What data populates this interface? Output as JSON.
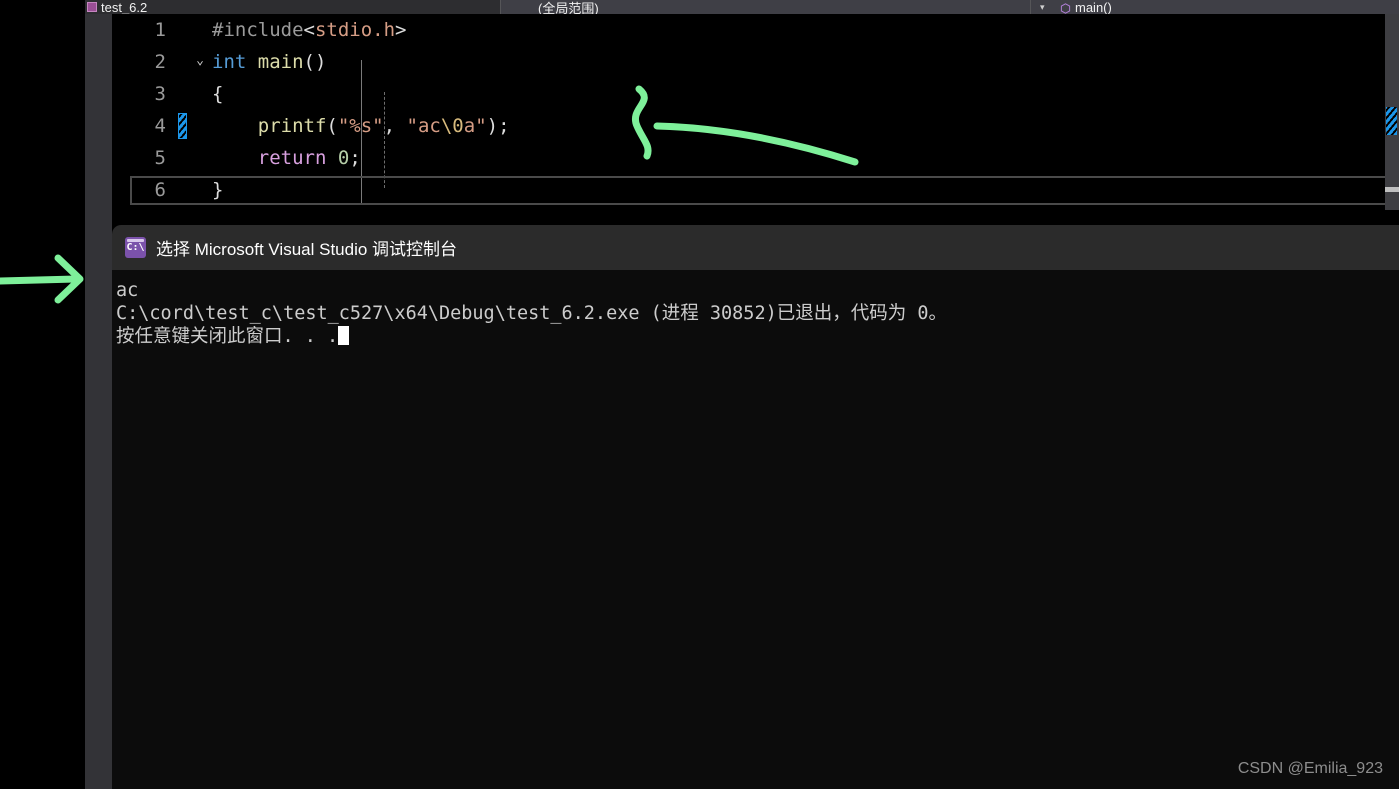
{
  "window": {
    "topbar": {
      "file_tab": {
        "label": "test_6.2",
        "icon": "c-file-icon"
      },
      "scope_dropdown": {
        "label": "(全局范围)",
        "icon": "chevron-down-icon"
      },
      "member_dropdown": {
        "label": "main()",
        "icon": "method-cube-icon"
      }
    }
  },
  "editor": {
    "lines": [
      {
        "number": "1",
        "changed": false,
        "fold": "",
        "text": "#include<stdio.h>"
      },
      {
        "number": "2",
        "changed": false,
        "fold": "open",
        "text": "int main()"
      },
      {
        "number": "3",
        "changed": false,
        "fold": "",
        "text": "{"
      },
      {
        "number": "4",
        "changed": true,
        "fold": "",
        "text": "printf(\"%s\", \"ac\\0a\");"
      },
      {
        "number": "5",
        "changed": false,
        "fold": "",
        "text": "return 0;"
      },
      {
        "number": "6",
        "changed": false,
        "fold": "",
        "text": "}"
      }
    ],
    "fold_chevron_glyph": "⌄"
  },
  "console": {
    "title": "选择 Microsoft Visual Studio 调试控制台",
    "icon_text": "C:\\",
    "output_lines": [
      "ac",
      "C:\\cord\\test_c\\test_c527\\x64\\Debug\\test_6.2.exe (进程 30852)已退出，代码为 0。",
      "按任意键关闭此窗口. . ."
    ]
  },
  "watermark": {
    "text": "CSDN @Emilia_923"
  },
  "annotations": {
    "arrow_color": "#7ef09a",
    "arrow_to_code": {
      "name": "green-arrow-pointing-to-printf"
    },
    "arrow_to_console": {
      "name": "green-arrow-pointing-to-output"
    }
  },
  "colors": {
    "editor_background": "#000000",
    "console_background": "#0c0c0c",
    "console_titlebar": "#2b2b2b",
    "topbar": "#3f3f46",
    "change_marker": "#1c97ea",
    "annotation_green": "#7ef09a"
  }
}
